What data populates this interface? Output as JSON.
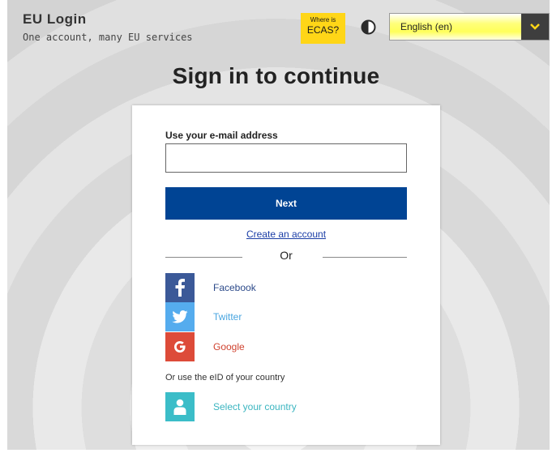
{
  "header": {
    "brand_title": "EU Login",
    "brand_tagline": "One account, many EU services",
    "ecas_small": "Where is",
    "ecas_big": "ECAS?",
    "language_selected": "English (en)"
  },
  "page": {
    "title": "Sign in to continue"
  },
  "form": {
    "email_label": "Use your e-mail address",
    "email_value": "",
    "next_label": "Next",
    "create_account": "Create an account",
    "or_text": "Or"
  },
  "social": [
    {
      "label": "Facebook",
      "icon": "facebook-icon",
      "color": "#3b5998",
      "text_color": "#2c4a8a"
    },
    {
      "label": "Twitter",
      "icon": "twitter-icon",
      "color": "#55acee",
      "text_color": "#4aa6e0"
    },
    {
      "label": "Google",
      "icon": "google-icon",
      "color": "#dd4b39",
      "text_color": "#d0422f"
    }
  ],
  "eid": {
    "prompt": "Or use the eID of your country",
    "select_label": "Select your country",
    "icon": "person-icon",
    "color": "#3bbdc8"
  },
  "colors": {
    "primary_blue": "#004494",
    "ecas_yellow": "#ffd617"
  }
}
